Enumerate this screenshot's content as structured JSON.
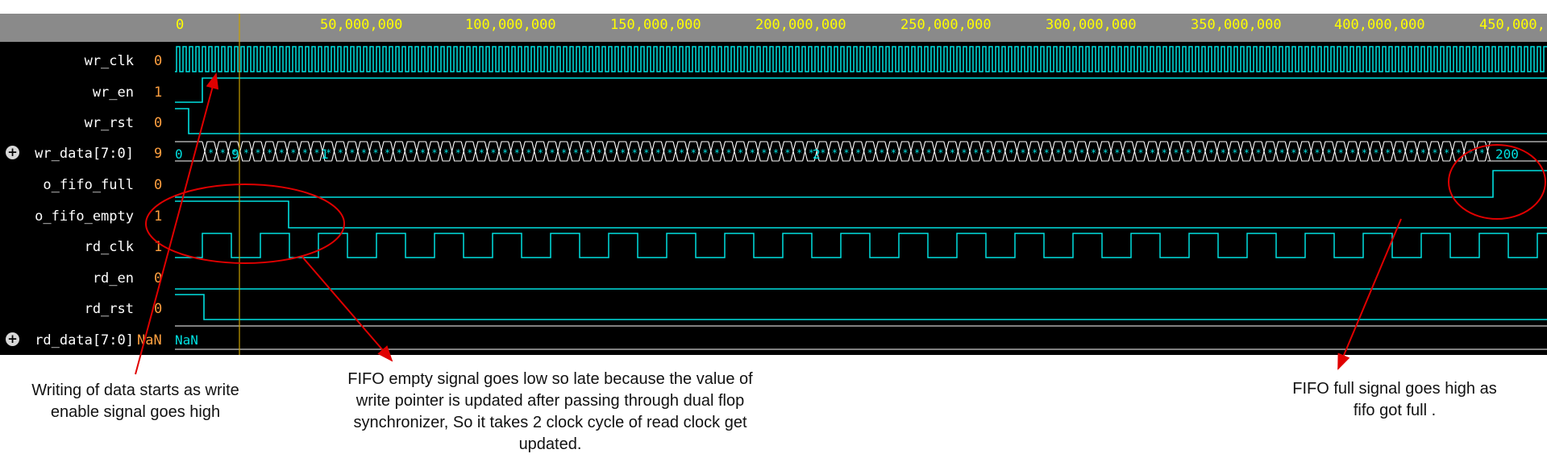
{
  "ruler": {
    "labels": [
      "0",
      "50,000,000",
      "100,000,000",
      "150,000,000",
      "200,000,000",
      "250,000,000",
      "300,000,000",
      "350,000,000",
      "400,000,000",
      "450,000,"
    ]
  },
  "signals": [
    {
      "name": "wr_clk",
      "value": "0"
    },
    {
      "name": "wr_en",
      "value": "1"
    },
    {
      "name": "wr_rst",
      "value": "0"
    },
    {
      "name": "wr_data[7:0]",
      "value": "9"
    },
    {
      "name": "o_fifo_full",
      "value": "0"
    },
    {
      "name": "o_fifo_empty",
      "value": "1"
    },
    {
      "name": "rd_clk",
      "value": "1"
    },
    {
      "name": "rd_en",
      "value": "0"
    },
    {
      "name": "rd_rst",
      "value": "0"
    },
    {
      "name": "rd_data[7:0]",
      "value": "NaN"
    }
  ],
  "bus_labels": {
    "wr_data_start": "0",
    "wr_data_mid1": "1",
    "wr_data_mid2": "2",
    "wr_data_end": "200",
    "wr_data_nine": "9",
    "rd_data": "NaN"
  },
  "annotations": {
    "write_start": "Writing of data starts  as write enable signal goes high",
    "fifo_empty": "FIFO empty signal goes low so late because the value of write pointer is updated after passing through dual flop synchronizer, So it takes 2 clock cycle of read clock get updated.",
    "fifo_full": "FIFO full signal goes high as fifo got full ."
  },
  "colors": {
    "clock": "#00e0e0",
    "clock_edge": "#00ff00",
    "ruler_text": "#ffff00",
    "signal_value": "#ffa040",
    "annotation": "#e00000",
    "cursor": "#c8a000"
  }
}
